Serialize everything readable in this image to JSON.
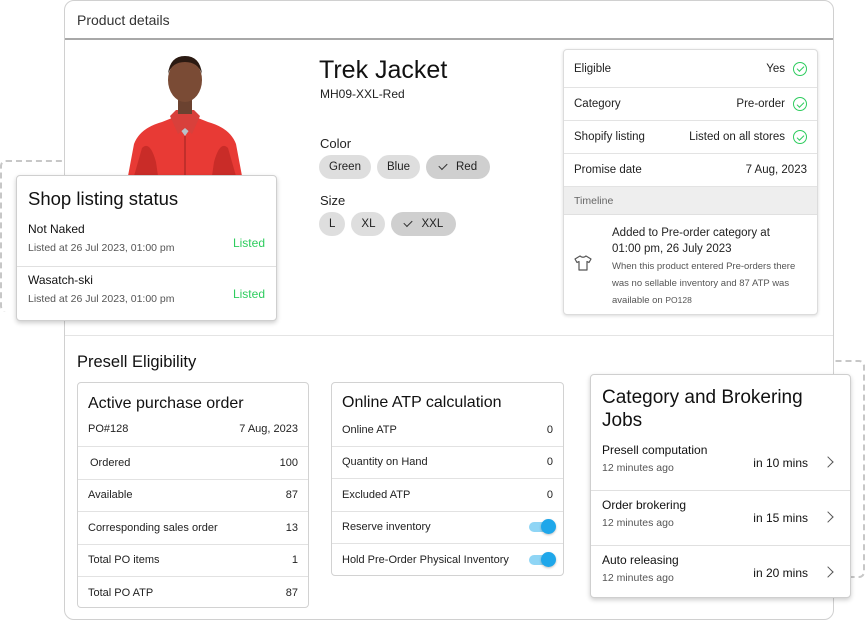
{
  "main": {
    "header": "Product details"
  },
  "product": {
    "title": "Trek Jacket",
    "sku": "MH09-XXL-Red",
    "color_label": "Color",
    "colors": [
      "Green",
      "Blue",
      "Red"
    ],
    "selected_color": "Red",
    "size_label": "Size",
    "sizes": [
      "L",
      "XL",
      "XXL"
    ],
    "selected_size": "XXL"
  },
  "eligibility": {
    "rows": [
      {
        "label": "Eligible",
        "value": "Yes"
      },
      {
        "label": "Category",
        "value": "Pre-order"
      },
      {
        "label": "Shopify listing",
        "value": "Listed on all stores"
      },
      {
        "label": "Promise date",
        "value": "7 Aug, 2023"
      }
    ],
    "timeline_label": "Timeline",
    "timeline": {
      "title": "Added to Pre-order category at 01:00 pm, 26 July 2023",
      "desc": "When this product entered Pre-orders there was no sellable inventory and 87 ATP was available on",
      "po": "PO128"
    }
  },
  "shop_listing": {
    "title": "Shop listing status",
    "items": [
      {
        "name": "Not Naked",
        "sub": "Listed at 26 Jul 2023, 01:00 pm",
        "status": "Listed"
      },
      {
        "name": "Wasatch-ski",
        "sub": "Listed at 26 Jul 2023, 01:00 pm",
        "status": "Listed"
      }
    ]
  },
  "presell": {
    "title": "Presell Eligibility",
    "po_card": {
      "title": "Active purchase order",
      "header_left": "PO#128",
      "header_right": "7 Aug, 2023",
      "rows": [
        {
          "label": "Ordered",
          "value": "100"
        },
        {
          "label": "Available",
          "value": "87"
        },
        {
          "label": "Corresponding sales order",
          "value": "13"
        },
        {
          "label": "Total PO items",
          "value": "1"
        },
        {
          "label": "Total PO ATP",
          "value": "87"
        }
      ]
    },
    "atp_card": {
      "title": "Online ATP calculation",
      "rows": [
        {
          "label": "Online ATP",
          "value": "0"
        },
        {
          "label": "Quantity on Hand",
          "value": "0"
        },
        {
          "label": "Excluded ATP",
          "value": "0"
        }
      ],
      "toggles": [
        {
          "label": "Reserve inventory"
        },
        {
          "label": "Hold Pre-Order Physical Inventory"
        }
      ]
    }
  },
  "jobs": {
    "title": "Category and Brokering Jobs",
    "items": [
      {
        "name": "Presell computation",
        "sub": "12 minutes ago",
        "when": "in 10 mins"
      },
      {
        "name": "Order brokering",
        "sub": "12 minutes ago",
        "when": "in 15 mins"
      },
      {
        "name": "Auto releasing",
        "sub": "12 minutes ago",
        "when": "in 20 mins"
      }
    ]
  },
  "colors": {
    "success": "#2ecc5e",
    "toggle": "#1fa7ea",
    "jacket": "#e83a35"
  },
  "icons": {
    "check": "check-circle-icon",
    "timeline": "tshirt-icon",
    "job": "chevron-right-icon"
  }
}
